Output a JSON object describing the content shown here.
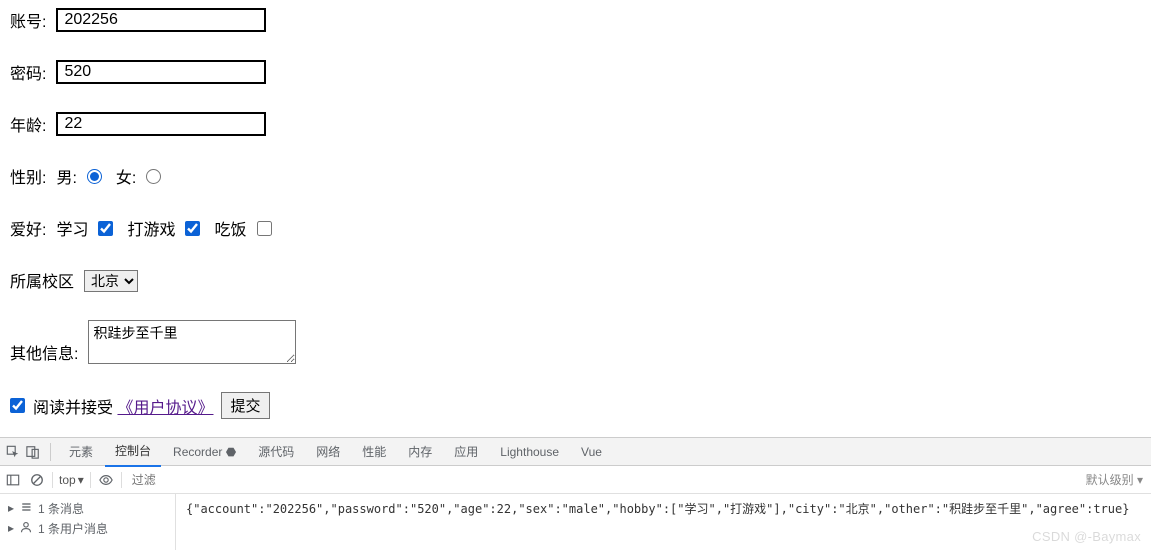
{
  "form": {
    "account": {
      "label": "账号:",
      "value": "202256"
    },
    "password": {
      "label": "密码:",
      "value": "520"
    },
    "age": {
      "label": "年龄:",
      "value": "22"
    },
    "sex": {
      "label": "性别:",
      "male_label": "男:",
      "female_label": "女:"
    },
    "hobby": {
      "label": "爱好:",
      "study": "学习",
      "game": "打游戏",
      "eat": "吃饭"
    },
    "campus": {
      "label": "所属校区",
      "selected": "北京"
    },
    "other": {
      "label": "其他信息:",
      "value": "积跬步至千里"
    },
    "agree": {
      "text": "阅读并接受",
      "link": "《用户协议》"
    },
    "submit": "提交"
  },
  "devtools": {
    "tabs": {
      "elements": "元素",
      "console": "控制台",
      "recorder": "Recorder",
      "sources": "源代码",
      "network": "网络",
      "performance": "性能",
      "memory": "内存",
      "application": "应用",
      "lighthouse": "Lighthouse",
      "vue": "Vue"
    },
    "toolbar": {
      "context": "top",
      "filter_placeholder": "过滤",
      "levels": "默认级别"
    },
    "sidebar": {
      "messages": "1 条消息",
      "user_msg": "1 条用户消息"
    },
    "log": "{\"account\":\"202256\",\"password\":\"520\",\"age\":22,\"sex\":\"male\",\"hobby\":[\"学习\",\"打游戏\"],\"city\":\"北京\",\"other\":\"积跬步至千里\",\"agree\":true}",
    "watermark": "CSDN @-Baymax"
  }
}
